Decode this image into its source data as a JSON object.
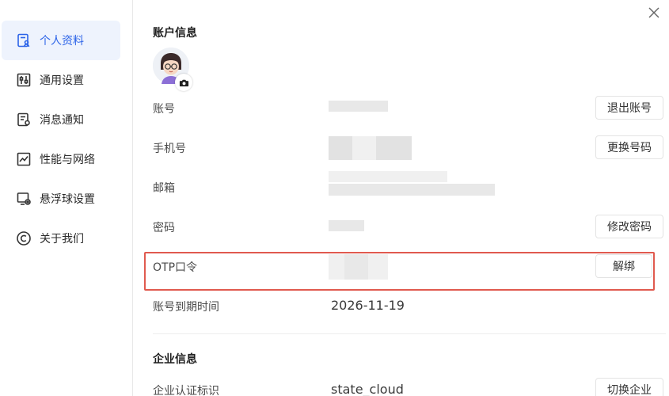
{
  "sidebar": {
    "items": [
      {
        "label": "个人资料",
        "icon": "profile-icon",
        "active": true
      },
      {
        "label": "通用设置",
        "icon": "sliders-icon",
        "active": false
      },
      {
        "label": "消息通知",
        "icon": "notification-icon",
        "active": false
      },
      {
        "label": "性能与网络",
        "icon": "chart-icon",
        "active": false
      },
      {
        "label": "悬浮球设置",
        "icon": "floating-ball-icon",
        "active": false
      },
      {
        "label": "关于我们",
        "icon": "copyright-icon",
        "active": false
      }
    ]
  },
  "account": {
    "title": "账户信息",
    "fields": {
      "account": {
        "label": "账号",
        "button": "退出账号"
      },
      "phone": {
        "label": "手机号",
        "button": "更换号码"
      },
      "email": {
        "label": "邮箱"
      },
      "password": {
        "label": "密码",
        "button": "修改密码"
      },
      "otp": {
        "label": "OTP口令",
        "button": "解绑"
      },
      "expiry": {
        "label": "账号到期时间",
        "value": "2026-11-19"
      }
    }
  },
  "enterprise": {
    "title": "企业信息",
    "fields": {
      "cert": {
        "label": "企业认证标识",
        "value": "state_cloud",
        "button": "切换企业"
      }
    }
  },
  "colors": {
    "accent": "#2b63e8",
    "active_bg": "#eef3fd",
    "highlight": "#e05a4f"
  }
}
